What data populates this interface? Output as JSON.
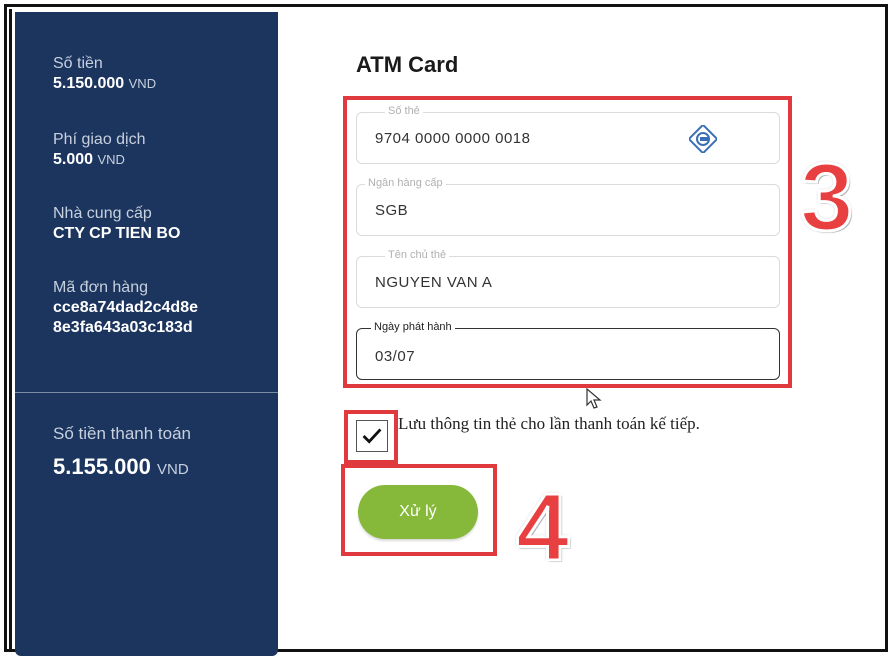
{
  "sidebar": {
    "amount": {
      "label": "Số tiền",
      "value": "5.150.000",
      "unit": "VND"
    },
    "fee": {
      "label": "Phí giao dịch",
      "value": "5.000",
      "unit": "VND"
    },
    "provider": {
      "label": "Nhà cung cấp",
      "value": "CTY CP TIEN BO"
    },
    "order": {
      "label": "Mã đơn hàng",
      "value_line1": "cce8a74dad2c4d8e",
      "value_line2": "8e3fa643a03c183d"
    },
    "total": {
      "label": "Số tiền thanh toán",
      "value": "5.155.000",
      "unit": "VND"
    }
  },
  "form": {
    "title": "ATM Card",
    "card_number": {
      "label": "Số thẻ",
      "value": "9704  0000  0000  0018",
      "icon": "bank-logo-icon"
    },
    "issuer": {
      "label": "Ngân hàng cấp",
      "value": "SGB"
    },
    "holder": {
      "label": "Tên chủ thẻ",
      "value": "NGUYEN VAN A"
    },
    "issue_date": {
      "label": "Ngày phát hành",
      "value": "03/07"
    },
    "save_info": {
      "label": "Lưu thông tin thẻ cho lần thanh toán kế tiếp.",
      "checked": true
    },
    "submit_label": "Xử lý"
  },
  "annotations": {
    "step3": "3",
    "step4": "4",
    "color": "#e0393e"
  },
  "colors": {
    "sidebar_bg": "#1c355e",
    "button": "#86b93a"
  }
}
